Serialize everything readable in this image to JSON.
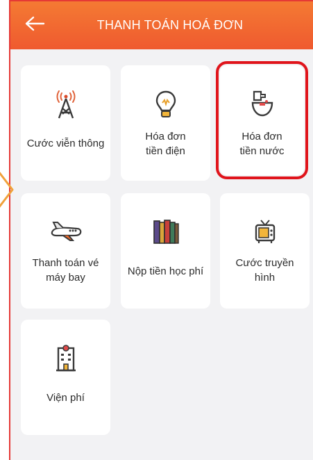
{
  "header": {
    "title": "THANH TOÁN HOÁ ĐƠN",
    "back_icon": "arrow-left-icon"
  },
  "services": [
    {
      "label": "Cước viễn thông",
      "icon": "antenna-tower-icon"
    },
    {
      "label": "Hóa đơn\ntiền điện",
      "icon": "light-bulb-icon"
    },
    {
      "label": "Hóa đơn\ntiền nước",
      "icon": "water-faucet-icon"
    },
    {
      "label": "Thanh toán vé\nmáy bay",
      "icon": "airplane-icon"
    },
    {
      "label": "Nộp tiền học phí",
      "icon": "books-icon"
    },
    {
      "label": "Cước truyền\nhình",
      "icon": "television-icon"
    },
    {
      "label": "Viện phí",
      "icon": "hospital-icon"
    }
  ],
  "colors": {
    "header_start": "#f47a33",
    "header_end": "#ef5a2f",
    "highlight": "#e0141b",
    "chevron": "#f0a13a"
  }
}
